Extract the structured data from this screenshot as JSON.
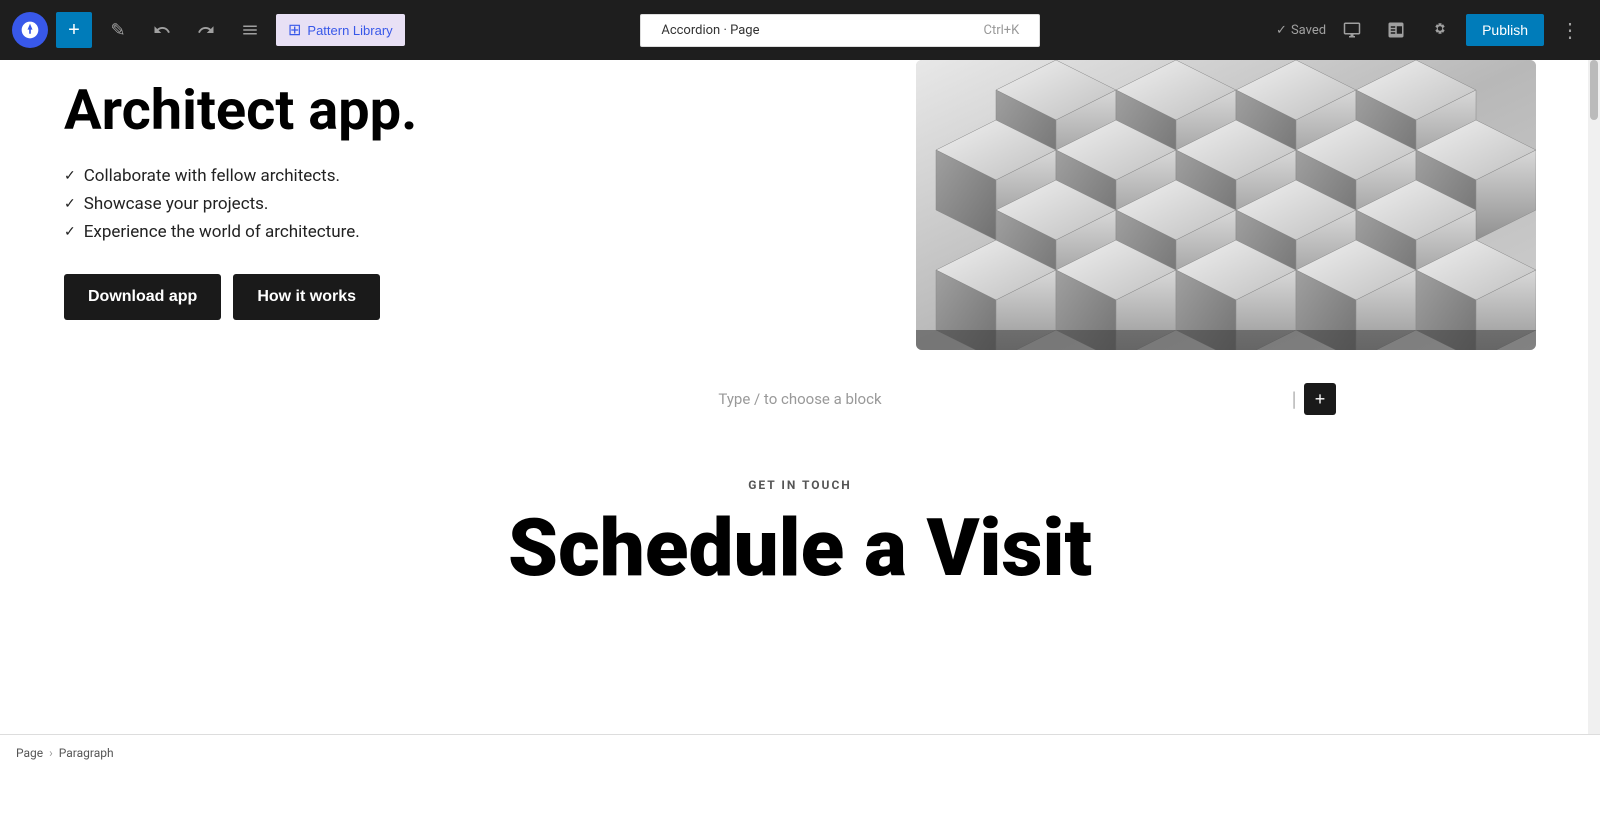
{
  "toolbar": {
    "wp_logo_label": "WordPress",
    "add_button_label": "+",
    "edit_icon_label": "✎",
    "undo_label": "↩",
    "redo_label": "↪",
    "tools_label": "≡",
    "pattern_library_label": "Pattern Library",
    "page_title": "Accordion · Page",
    "shortcut": "Ctrl+K",
    "saved_text": "Saved",
    "publish_label": "Publish",
    "more_options_label": "⋮"
  },
  "hero": {
    "title": "Architect app.",
    "features": [
      "Collaborate with fellow architects.",
      "Showcase your projects.",
      "Experience the world of architecture."
    ],
    "download_btn": "Download app",
    "howitworks_btn": "How it works"
  },
  "empty_block": {
    "placeholder": "Type / to choose a block"
  },
  "get_in_touch": {
    "label": "GET IN TOUCH",
    "title": "Schedule a Visit"
  },
  "status_bar": {
    "page_label": "Page",
    "separator": "›",
    "paragraph_label": "Paragraph"
  },
  "colors": {
    "accent_blue": "#007cba",
    "dark_bg": "#1e1e1e",
    "pattern_bg": "#e8e0f5",
    "pattern_text": "#3858e9"
  }
}
